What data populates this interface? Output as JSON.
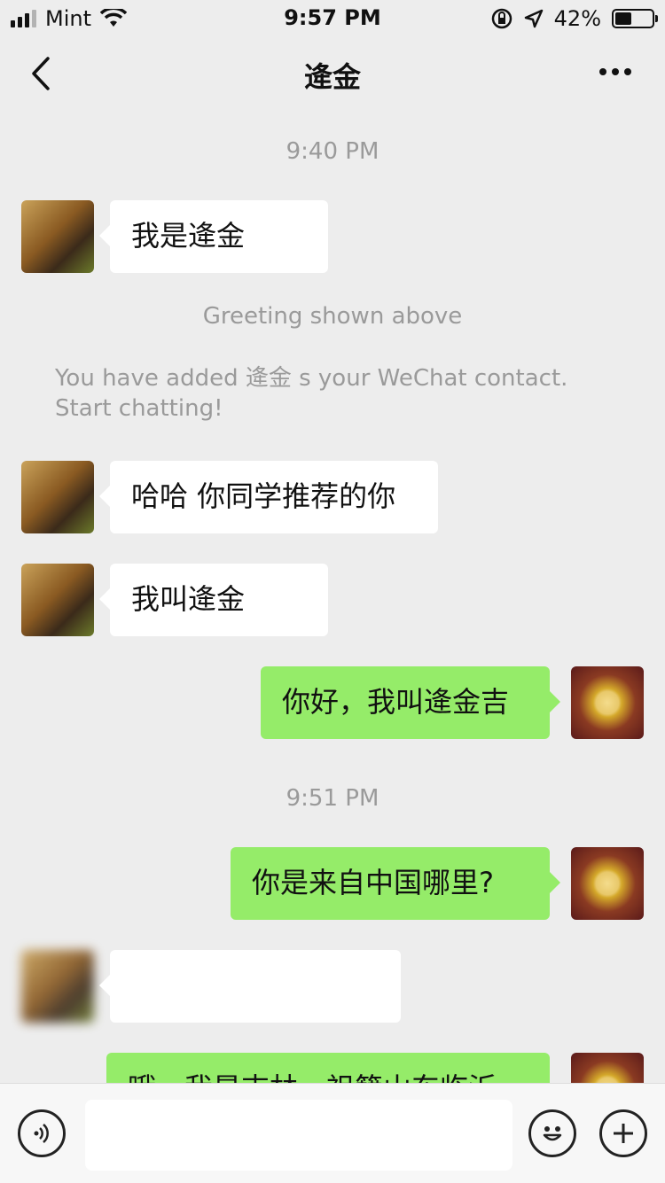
{
  "status_bar": {
    "carrier": "Mint",
    "time": "9:57 PM",
    "battery": "42%",
    "battery_level": 0.42,
    "icons": [
      "signal-icon",
      "wifi-icon",
      "orientation-lock-icon",
      "location-icon",
      "battery-icon"
    ]
  },
  "nav": {
    "title": "逄金",
    "back_icon": "chevron-left-icon",
    "more_icon": "more-dots-icon"
  },
  "chat": {
    "timestamp_1": "9:40 PM",
    "msg_1": "我是逄金",
    "system_greeting": "Greeting shown above",
    "system_added_1": "You have added 逄金",
    "system_added_2": "s your WeChat contact.",
    "system_added_3": "Start chatting!",
    "msg_2": "哈哈 你同学推荐的你",
    "msg_3": "我叫逄金",
    "msg_4": "你好，我叫逄金吉",
    "timestamp_2": "9:51 PM",
    "msg_5": "你是来自中国哪里?",
    "msg_6": "",
    "msg_7_partial": "哦，我是吉林，祖籍山东临沂"
  },
  "input_bar": {
    "voice_icon": "voice-icon",
    "emoji_icon": "emoji-icon",
    "add_icon": "plus-icon",
    "input_value": ""
  },
  "colors": {
    "background": "#ededed",
    "bubble_out": "#95ec69",
    "bubble_in": "#ffffff",
    "muted_text": "#9a9a9a"
  }
}
